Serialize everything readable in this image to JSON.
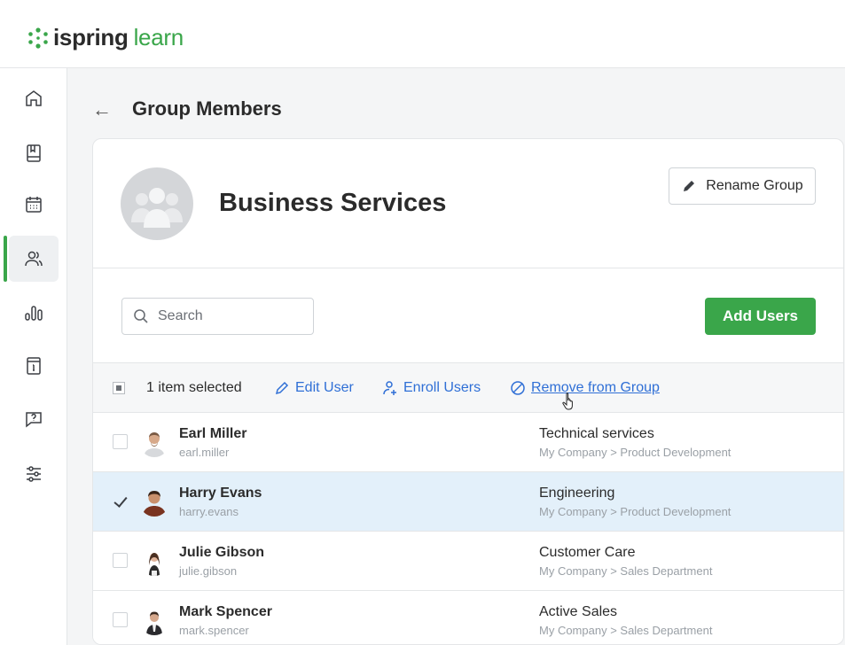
{
  "app": {
    "logo_main": "ispring",
    "logo_accent": "learn",
    "accent_color": "#3aa64a"
  },
  "sidebar": {
    "items": [
      {
        "icon": "home-icon"
      },
      {
        "icon": "book-icon"
      },
      {
        "icon": "calendar-icon"
      },
      {
        "icon": "users-icon",
        "active": true
      },
      {
        "icon": "reports-icon"
      },
      {
        "icon": "info-card-icon"
      },
      {
        "icon": "question-icon"
      },
      {
        "icon": "settings-sliders-icon"
      }
    ]
  },
  "header": {
    "back": "←",
    "title": "Group Members"
  },
  "group": {
    "name": "Business Services",
    "rename_label": "Rename Group"
  },
  "toolbar": {
    "search_placeholder": "Search",
    "add_users_label": "Add Users"
  },
  "selection": {
    "count_text": "1 item selected",
    "edit_user": "Edit User",
    "enroll_users": "Enroll Users",
    "remove_from_group": "Remove from Group"
  },
  "users": [
    {
      "name": "Earl Miller",
      "login": "earl.miller",
      "department": "Technical services",
      "path": "My Company > Product Development",
      "selected": false
    },
    {
      "name": "Harry Evans",
      "login": "harry.evans",
      "department": "Engineering",
      "path": "My Company > Product Development",
      "selected": true
    },
    {
      "name": "Julie Gibson",
      "login": "julie.gibson",
      "department": "Customer Care",
      "path": "My Company > Sales Department",
      "selected": false
    },
    {
      "name": "Mark Spencer",
      "login": "mark.spencer",
      "department": "Active Sales",
      "path": "My Company > Sales Department",
      "selected": false
    }
  ]
}
